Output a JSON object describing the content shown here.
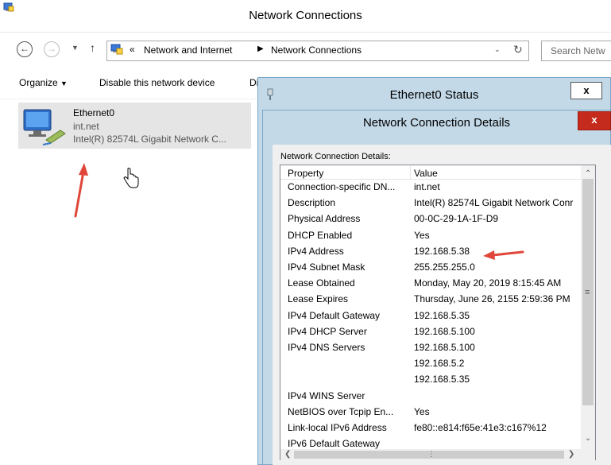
{
  "window": {
    "title": "Network Connections"
  },
  "address": {
    "breadcrumb_overflow": "«",
    "crumbs": [
      "Network and Internet",
      "Network Connections"
    ],
    "search_placeholder": "Search Netw"
  },
  "commands": [
    "Organize",
    "Disable this network device",
    "Di"
  ],
  "item": {
    "name": "Ethernet0",
    "domain": "int.net",
    "adapter": "Intel(R) 82574L Gigabit Network C..."
  },
  "status_dialog": {
    "title": "Ethernet0 Status",
    "close": "x"
  },
  "details_dialog": {
    "title": "Network Connection Details",
    "close": "x",
    "label": "Network Connection Details:",
    "columns": [
      "Property",
      "Value"
    ],
    "rows": [
      [
        "Connection-specific DN...",
        "int.net"
      ],
      [
        "Description",
        "Intel(R) 82574L Gigabit Network Conr"
      ],
      [
        "Physical Address",
        "00-0C-29-1A-1F-D9"
      ],
      [
        "DHCP Enabled",
        "Yes"
      ],
      [
        "IPv4 Address",
        "192.168.5.38"
      ],
      [
        "IPv4 Subnet Mask",
        "255.255.255.0"
      ],
      [
        "Lease Obtained",
        "Monday, May 20, 2019 8:15:45 AM"
      ],
      [
        "Lease Expires",
        "Thursday, June 26, 2155 2:59:36 PM"
      ],
      [
        "IPv4 Default Gateway",
        "192.168.5.35"
      ],
      [
        "IPv4 DHCP Server",
        "192.168.5.100"
      ],
      [
        "IPv4 DNS Servers",
        "192.168.5.100"
      ],
      [
        "",
        "192.168.5.2"
      ],
      [
        "",
        "192.168.5.35"
      ],
      [
        "IPv4 WINS Server",
        ""
      ],
      [
        "NetBIOS over Tcpip En...",
        "Yes"
      ],
      [
        "Link-local IPv6 Address",
        "fe80::e814:f65e:41e3:c167%12"
      ],
      [
        "IPv6 Default Gateway",
        ""
      ]
    ]
  },
  "colors": {
    "dialog_frame": "#c3d9e8",
    "close_red": "#c42b1c",
    "annotation_arrow": "#e0473a",
    "selected_item": "#e5e5e5"
  }
}
